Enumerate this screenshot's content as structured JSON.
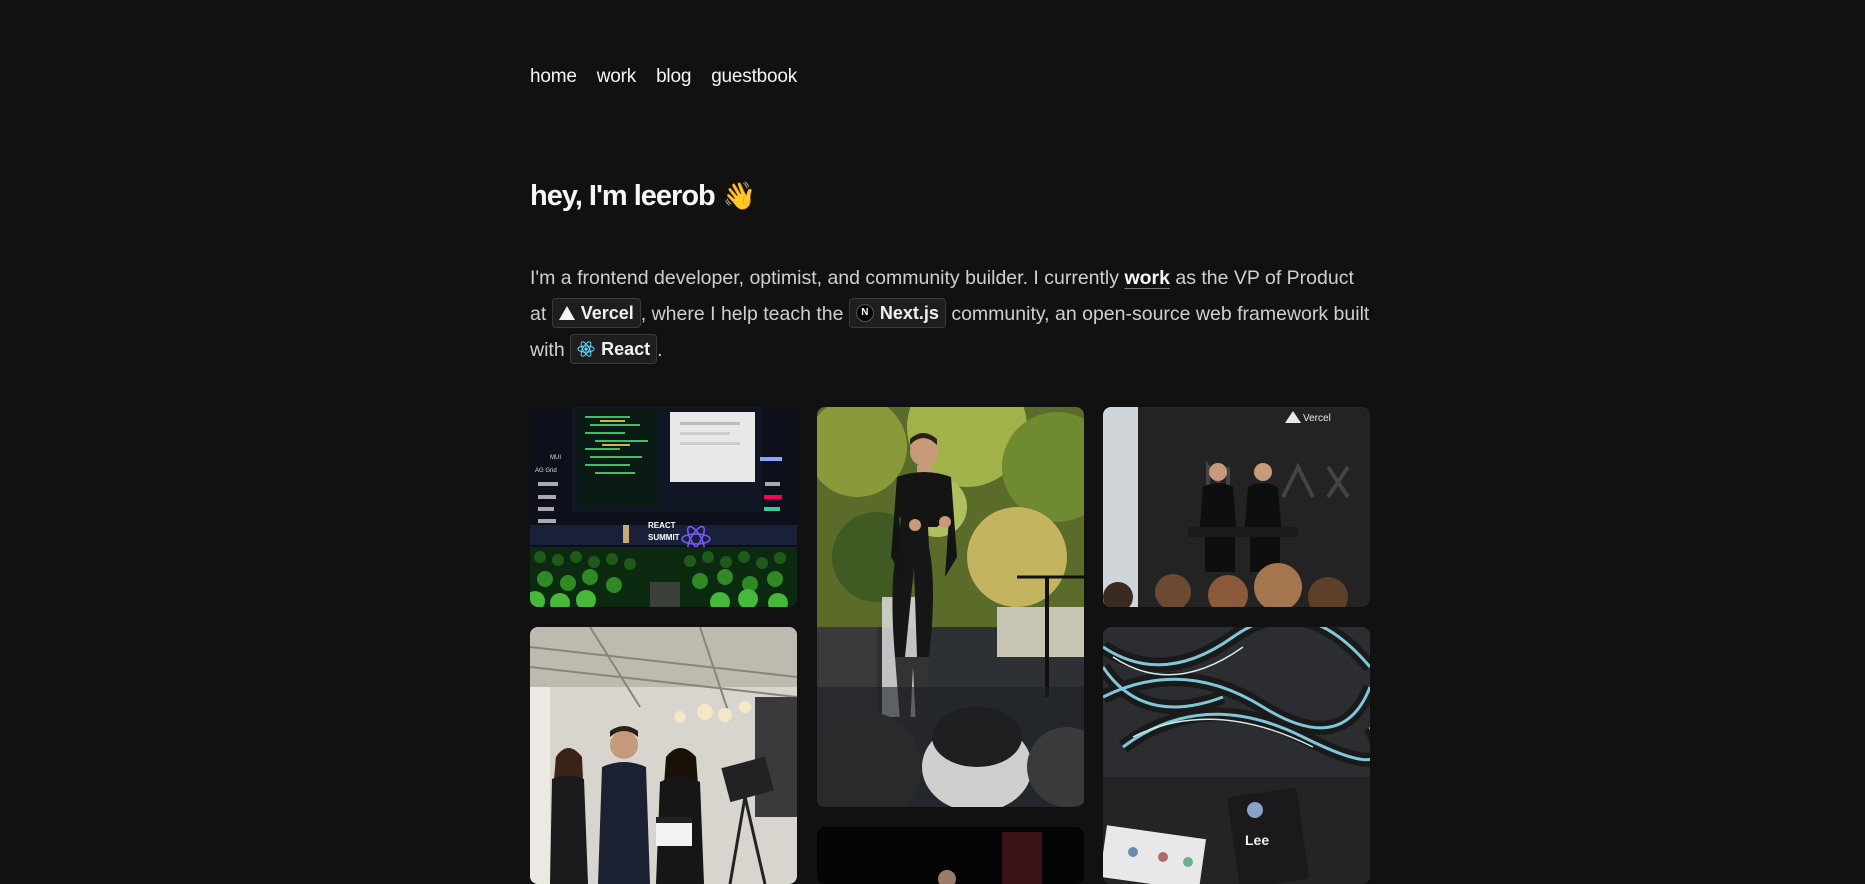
{
  "nav": {
    "items": [
      {
        "label": "home"
      },
      {
        "label": "work"
      },
      {
        "label": "blog"
      },
      {
        "label": "guestbook"
      }
    ]
  },
  "hero": {
    "title": "hey, I'm leerob",
    "wave_emoji": "👋"
  },
  "intro": {
    "part1": "I'm a frontend developer, optimist, and community builder. I currently ",
    "work_link": "work",
    "part2": " as the VP of Product at ",
    "vercel_badge": "Vercel",
    "part3": ", where I help teach the ",
    "nextjs_badge": "Next.js",
    "part4": " community, an open-source web framework built with ",
    "react_badge": "React",
    "part5": "."
  },
  "gallery": {
    "photos": [
      {
        "name": "photo-react-summit-stage",
        "signage": [
          "REACT",
          "SUMMIT"
        ],
        "sidebar_text": [
          "MUI",
          "AG Grid"
        ]
      },
      {
        "name": "photo-speaker-outdoor"
      },
      {
        "name": "photo-vercel-panel",
        "signage": [
          "Vercel"
        ]
      },
      {
        "name": "photo-group-studio"
      },
      {
        "name": "photo-vercel-lanyards",
        "badge_name": "Lee"
      },
      {
        "name": "photo-dark-stage"
      }
    ]
  },
  "colors": {
    "background": "#111111",
    "text": "#ededed",
    "muted": "#cfcfcf",
    "badge_bg": "#1e1e1e",
    "badge_border": "#3a3a3a"
  }
}
